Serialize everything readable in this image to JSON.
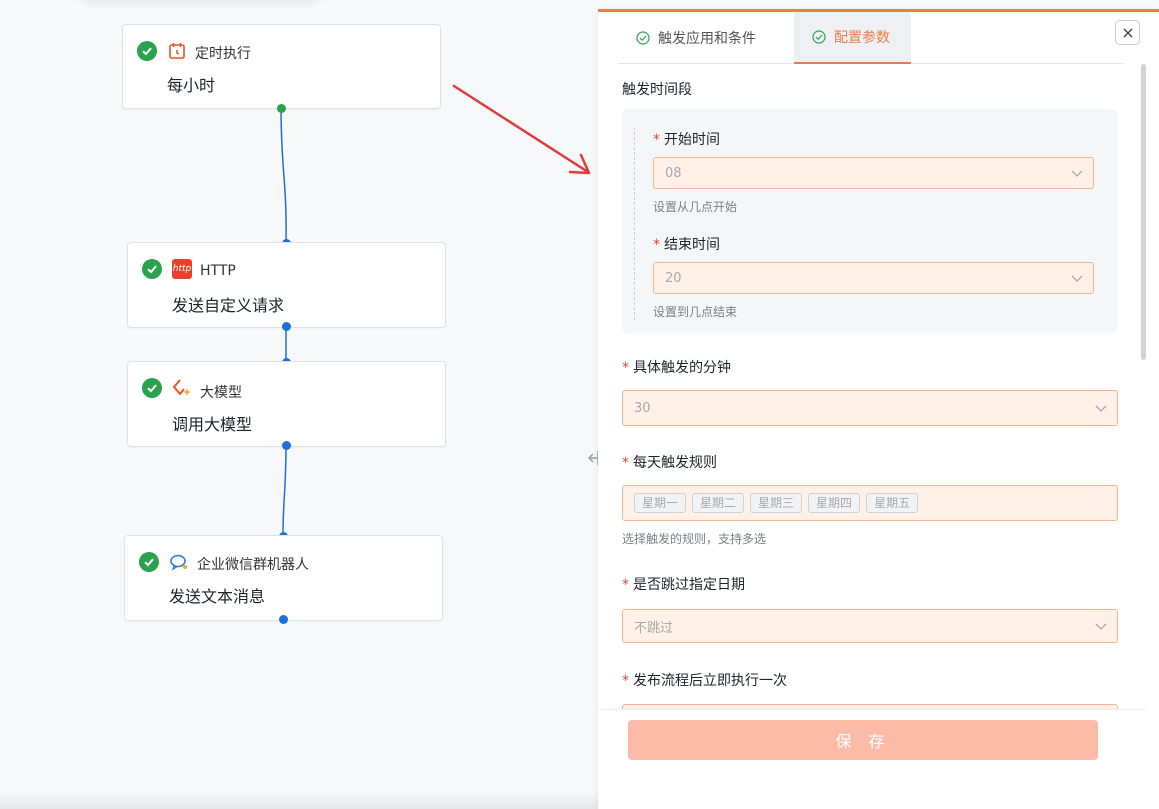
{
  "canvas": {
    "nodes": [
      {
        "app": "定时执行",
        "action": "每小时"
      },
      {
        "app": "HTTP",
        "action": "发送自定义请求",
        "badge": "http"
      },
      {
        "app": "大模型",
        "action": "调用大模型"
      },
      {
        "app": "企业微信群机器人",
        "action": "发送文本消息"
      }
    ]
  },
  "panel": {
    "tabs": [
      {
        "label": "触发应用和条件"
      },
      {
        "label": "配置参数"
      }
    ],
    "section_title": "触发时间段",
    "start_time": {
      "label": "开始时间",
      "value": "08",
      "hint": "设置从几点开始"
    },
    "end_time": {
      "label": "结束时间",
      "value": "20",
      "hint": "设置到几点结束"
    },
    "minute": {
      "label": "具体触发的分钟",
      "value": "30"
    },
    "daily_rule": {
      "label": "每天触发规则",
      "tags": [
        "星期一",
        "星期二",
        "星期三",
        "星期四",
        "星期五"
      ],
      "hint": "选择触发的规则，支持多选"
    },
    "skip_date": {
      "label": "是否跳过指定日期",
      "value": "不跳过"
    },
    "run_once": {
      "label": "发布流程后立即执行一次"
    },
    "save_label": "保 存"
  },
  "colors": {
    "accent": "#f07b4a",
    "success": "#2ba24c",
    "port": "#1d6fe0",
    "arrow": "#e23a3a"
  }
}
